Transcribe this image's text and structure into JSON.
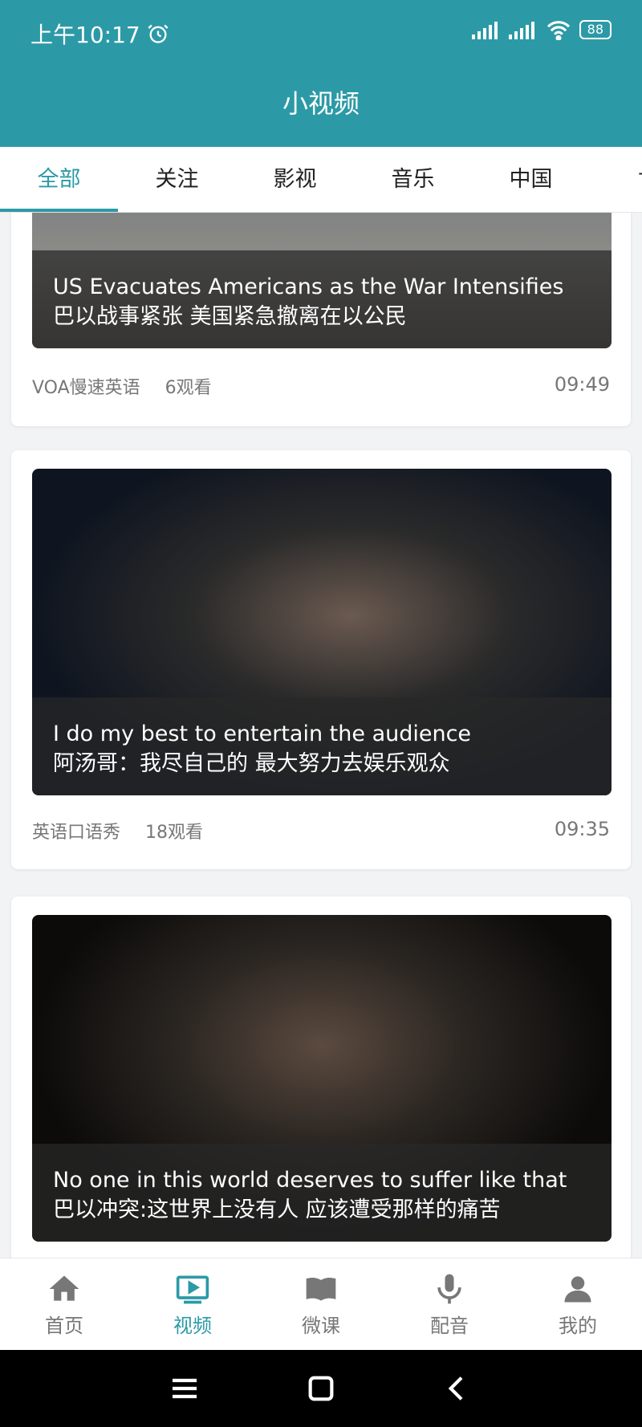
{
  "status": {
    "time": "上午10:17",
    "battery": "88"
  },
  "header": {
    "title": "小视频"
  },
  "tabs": [
    {
      "label": "全部",
      "active": true
    },
    {
      "label": "关注",
      "active": false
    },
    {
      "label": "影视",
      "active": false
    },
    {
      "label": "音乐",
      "active": false
    },
    {
      "label": "中国",
      "active": false
    },
    {
      "label": "世",
      "active": false
    }
  ],
  "videos": [
    {
      "title_en": "US Evacuates Americans as the War Intensifies",
      "title_cn": "巴以战事紧张 美国紧急撤离在以公民",
      "source": "VOA慢速英语",
      "views": "6观看",
      "duration": "09:49"
    },
    {
      "title_en": "I do my best to entertain the audience",
      "title_cn": "阿汤哥：我尽自己的 最大努力去娱乐观众",
      "source": "英语口语秀",
      "views": "18观看",
      "duration": "09:35"
    },
    {
      "title_en": "No one in this world  deserves to suffer like that",
      "title_cn": "巴以冲突:这世界上没有人 应该遭受那样的痛苦",
      "source": "",
      "views": "",
      "duration": ""
    }
  ],
  "bottom_nav": [
    {
      "label": "首页",
      "icon": "home-icon",
      "active": false
    },
    {
      "label": "视频",
      "icon": "video-icon",
      "active": true
    },
    {
      "label": "微课",
      "icon": "book-icon",
      "active": false
    },
    {
      "label": "配音",
      "icon": "microphone-icon",
      "active": false
    },
    {
      "label": "我的",
      "icon": "user-icon",
      "active": false
    }
  ],
  "colors": {
    "accent": "#2c9aa6"
  }
}
